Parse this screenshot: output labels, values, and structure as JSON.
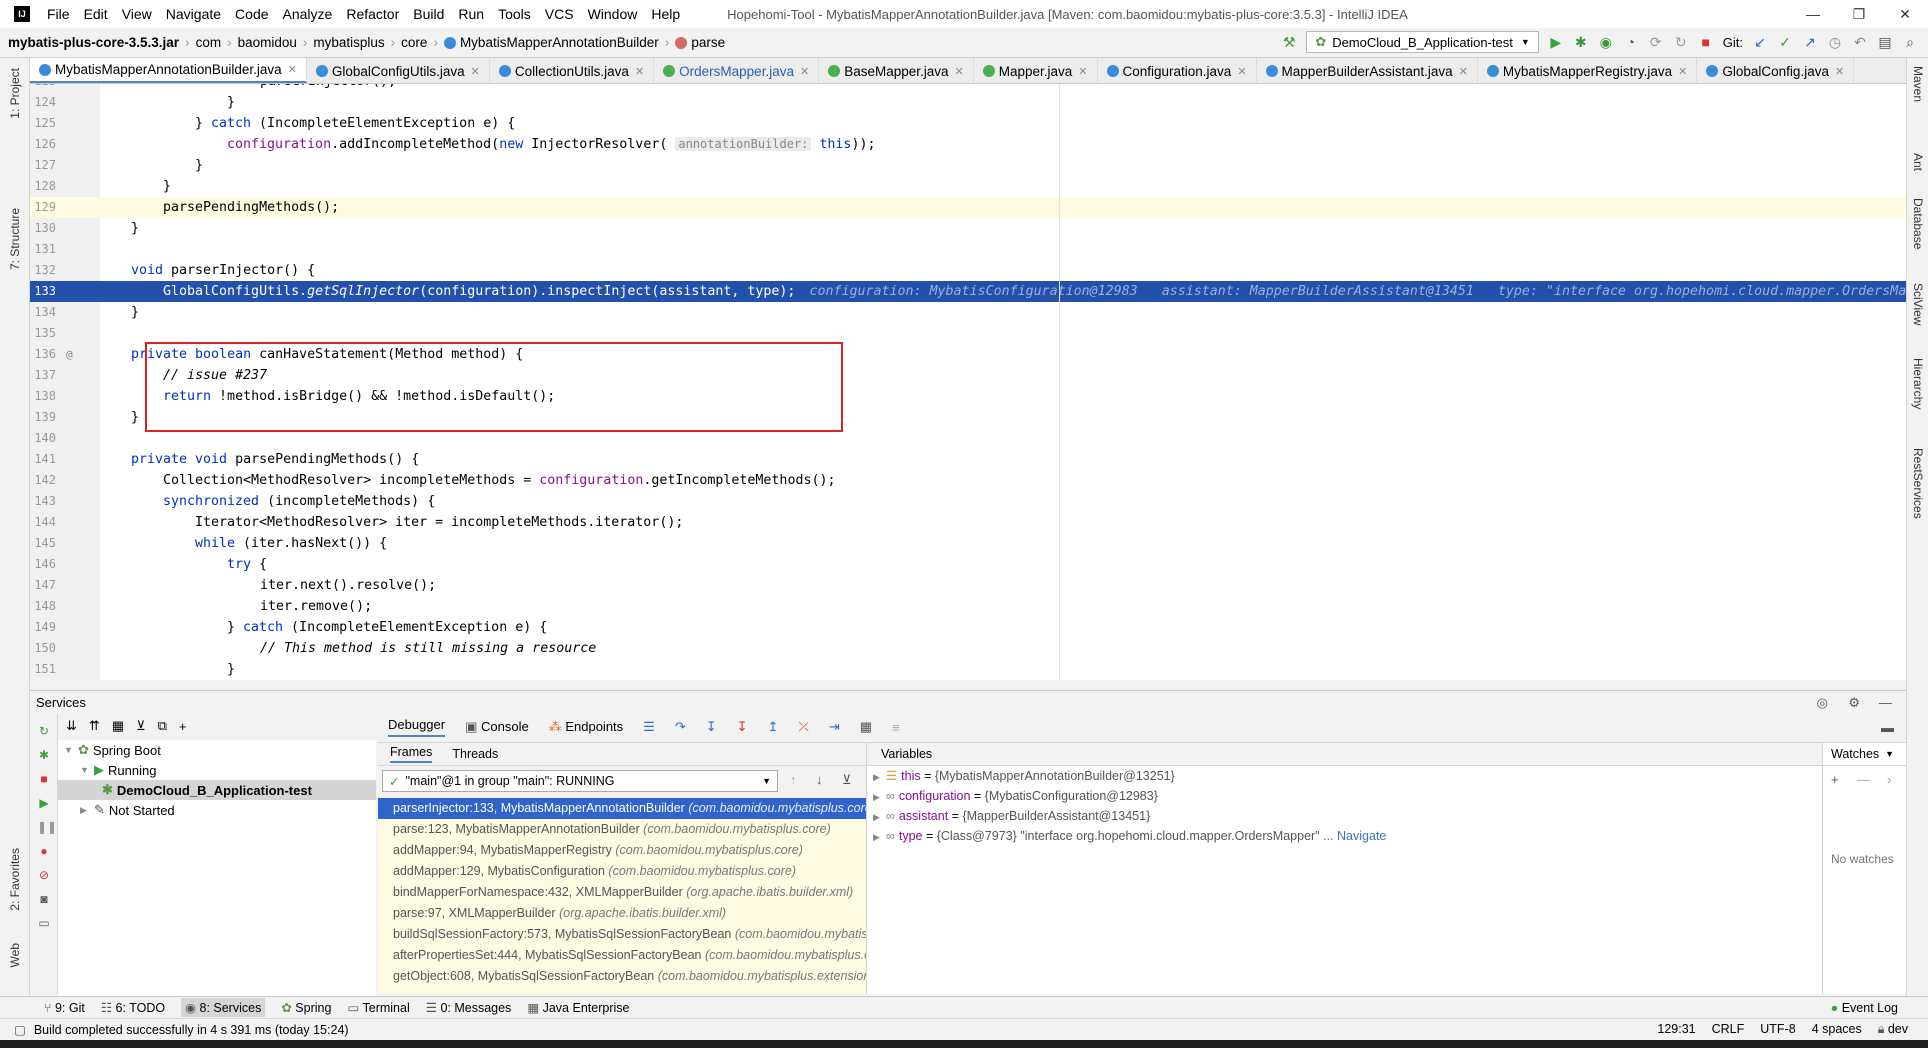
{
  "window": {
    "title": "Hopehomi-Tool - MybatisMapperAnnotationBuilder.java [Maven: com.baomidou:mybatis-plus-core:3.5.3] - IntelliJ IDEA",
    "menu": [
      "File",
      "Edit",
      "View",
      "Navigate",
      "Code",
      "Analyze",
      "Refactor",
      "Build",
      "Run",
      "Tools",
      "VCS",
      "Window",
      "Help"
    ],
    "controls": [
      "—",
      "❐",
      "✕"
    ]
  },
  "breadcrumb": {
    "jar": "mybatis-plus-core-3.5.3.jar",
    "parts": [
      "com",
      "baomidou",
      "mybatisplus",
      "core"
    ],
    "class": "MybatisMapperAnnotationBuilder",
    "method": "parse"
  },
  "run_config": "DemoCloud_B_Application-test",
  "git_label": "Git:",
  "tabs": [
    "MybatisMapperAnnotationBuilder.java",
    "GlobalConfigUtils.java",
    "CollectionUtils.java",
    "OrdersMapper.java",
    "BaseMapper.java",
    "Mapper.java",
    "Configuration.java",
    "MapperBuilderAssistant.java",
    "MybatisMapperRegistry.java",
    "GlobalConfig.java"
  ],
  "left_strip": [
    "1: Project",
    "7: Structure",
    "2: Favorites",
    "Web"
  ],
  "right_strip": [
    "Maven",
    "Ant",
    "Database",
    "SciView",
    "Hierarchy",
    "RestServices"
  ],
  "code": {
    "line_numbers": [
      "123",
      "124",
      "125",
      "126",
      "127",
      "128",
      "129",
      "130",
      "131",
      "132",
      "133",
      "134",
      "135",
      "136",
      "137",
      "138",
      "139",
      "140",
      "141",
      "142",
      "143",
      "144",
      "145",
      "146",
      "147",
      "148",
      "149",
      "150",
      "151"
    ],
    "l123": "parserInjector();",
    "l124": "}",
    "l125_a": "} ",
    "l125_kw": "catch",
    "l125_b": " (IncompleteElementException e) {",
    "l126_fld": "configuration",
    "l126_a": ".addIncompleteMethod(",
    "l126_kw": "new",
    "l126_b": " InjectorResolver( ",
    "l126_hint": "annotationBuilder:",
    "l126_kw2": "this",
    "l126_c": "));",
    "l127": "}",
    "l128": "}",
    "l129": "parsePendingMethods();",
    "l130": "}",
    "l132_kw": "void",
    "l132_a": " parserInjector() {",
    "l133_a": "GlobalConfigUtils.",
    "l133_it": "getSqlInjector",
    "l133_b": "(configuration).inspectInject(assistant, type);",
    "l133_inlay": "configuration: MybatisConfiguration@12983   assistant: MapperBuilderAssistant@13451   type: \"interface org.hopehomi.cloud.mapper.OrdersMapper\"",
    "l134": "}",
    "l136_kw": "private boolean",
    "l136_a": " canHaveStatement(Method method) {",
    "l137": "// issue #237",
    "l138_kw": "return",
    "l138_a": " !method.isBridge() && !method.isDefault();",
    "l139": "}",
    "l141_kw": "private void",
    "l141_a": " parsePendingMethods() {",
    "l142_a": "Collection<MethodResolver> incompleteMethods = ",
    "l142_fld": "configuration",
    "l142_b": ".getIncompleteMethods();",
    "l143_kw": "synchronized",
    "l143_a": " (incompleteMethods) {",
    "l144": "Iterator<MethodResolver> iter = incompleteMethods.iterator();",
    "l145_kw": "while",
    "l145_a": " (iter.hasNext()) {",
    "l146_kw": "try",
    "l146_a": " {",
    "l147": "iter.next().resolve();",
    "l148": "iter.remove();",
    "l149_a": "} ",
    "l149_kw": "catch",
    "l149_b": " (IncompleteElementException e) {",
    "l150": "// This method is still missing a resource",
    "l151": "}"
  },
  "services": {
    "title": "Services",
    "tree": {
      "root": "Spring Boot",
      "running": "Running",
      "app": "DemoCloud_B_Application-test",
      "not_started": "Not Started"
    }
  },
  "debugger": {
    "tabs": [
      "Debugger",
      "Console",
      "Endpoints"
    ],
    "frames_tab": "Frames",
    "threads_tab": "Threads",
    "thread": "\"main\"@1 in group \"main\": RUNNING",
    "frames": [
      {
        "m": "parserInjector:133, MybatisMapperAnnotationBuilder",
        "p": "(com.baomidou.mybatisplus.core)"
      },
      {
        "m": "parse:123, MybatisMapperAnnotationBuilder",
        "p": "(com.baomidou.mybatisplus.core)"
      },
      {
        "m": "addMapper:94, MybatisMapperRegistry",
        "p": "(com.baomidou.mybatisplus.core)"
      },
      {
        "m": "addMapper:129, MybatisConfiguration",
        "p": "(com.baomidou.mybatisplus.core)"
      },
      {
        "m": "bindMapperForNamespace:432, XMLMapperBuilder",
        "p": "(org.apache.ibatis.builder.xml)"
      },
      {
        "m": "parse:97, XMLMapperBuilder",
        "p": "(org.apache.ibatis.builder.xml)"
      },
      {
        "m": "buildSqlSessionFactory:573, MybatisSqlSessionFactoryBean",
        "p": "(com.baomidou.mybatisplus.extension.spring)"
      },
      {
        "m": "afterPropertiesSet:444, MybatisSqlSessionFactoryBean",
        "p": "(com.baomidou.mybatisplus.extension.spring)"
      },
      {
        "m": "getObject:608, MybatisSqlSessionFactoryBean",
        "p": "(com.baomidou.mybatisplus.extension.spring)"
      }
    ],
    "variables_title": "Variables",
    "variables": [
      {
        "name": "this",
        "value": "{MybatisMapperAnnotationBuilder@13251}"
      },
      {
        "name": "configuration",
        "value": "{MybatisConfiguration@12983}"
      },
      {
        "name": "assistant",
        "value": "{MapperBuilderAssistant@13451}"
      },
      {
        "name": "type",
        "value": "{Class@7973} \"interface org.hopehomi.cloud.mapper.OrdersMapper\"",
        "link": "... Navigate"
      }
    ],
    "watches_title": "Watches",
    "no_watches": "No watches"
  },
  "bottom_tabs": [
    "9: Git",
    "6: TODO",
    "8: Services",
    "Spring",
    "Terminal",
    "0: Messages",
    "Java Enterprise"
  ],
  "event_log": "Event Log",
  "status": {
    "message": "Build completed successfully in 4 s 391 ms (today 15:24)",
    "position": "129:31",
    "line_sep": "CRLF",
    "encoding": "UTF-8",
    "indent": "4 spaces",
    "branch": "dev"
  }
}
